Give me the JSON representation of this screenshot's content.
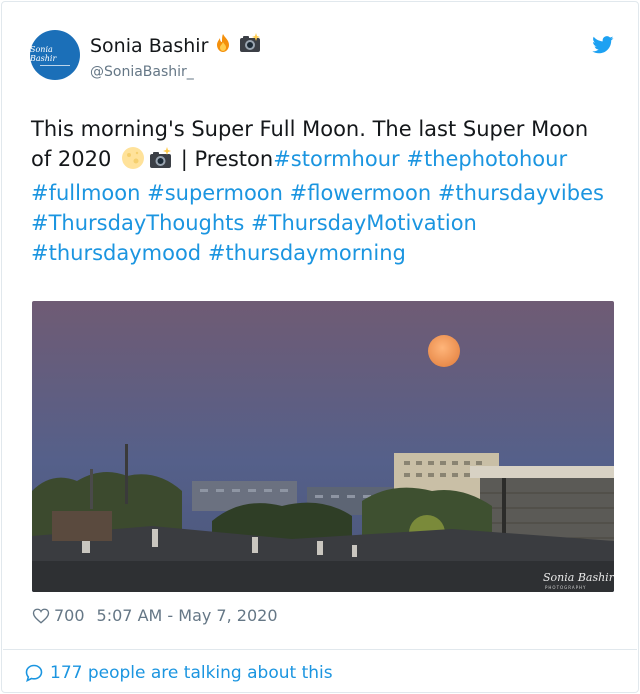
{
  "tweet": {
    "author": {
      "display_name": "Sonia Bashir",
      "handle": "@SoniaBashir_",
      "avatar_text": "Sonia Bashir",
      "name_emojis": [
        "fire-icon",
        "camera-flash-icon"
      ]
    },
    "text": {
      "part1": "This morning's Super Full Moon.  The last Super Moon of 2020 ",
      "part2": " | Preston",
      "hashtags": [
        "#stormhour",
        "#thephotohour",
        "#fullmoon",
        "#supermoon",
        "#flowermoon",
        "#thursdayvibes",
        "#ThursdayThoughts",
        "#ThursdayMotivation",
        "#thursdaymood",
        "#thursdaymorning"
      ]
    },
    "photo": {
      "watermark": "Sonia Bashir",
      "watermark_sub": "PHOTOGRAPHY"
    },
    "likes": "700",
    "timestamp": "5:07 AM - May 7, 2020",
    "conversation": "177 people are talking about this"
  },
  "colors": {
    "link": "#1b95e0",
    "secondary": "#657786",
    "avatar": "#1b6fb8",
    "sky_top": "#6e5a73",
    "sky_bottom": "#4b5a78",
    "moon": "#f0a060"
  }
}
